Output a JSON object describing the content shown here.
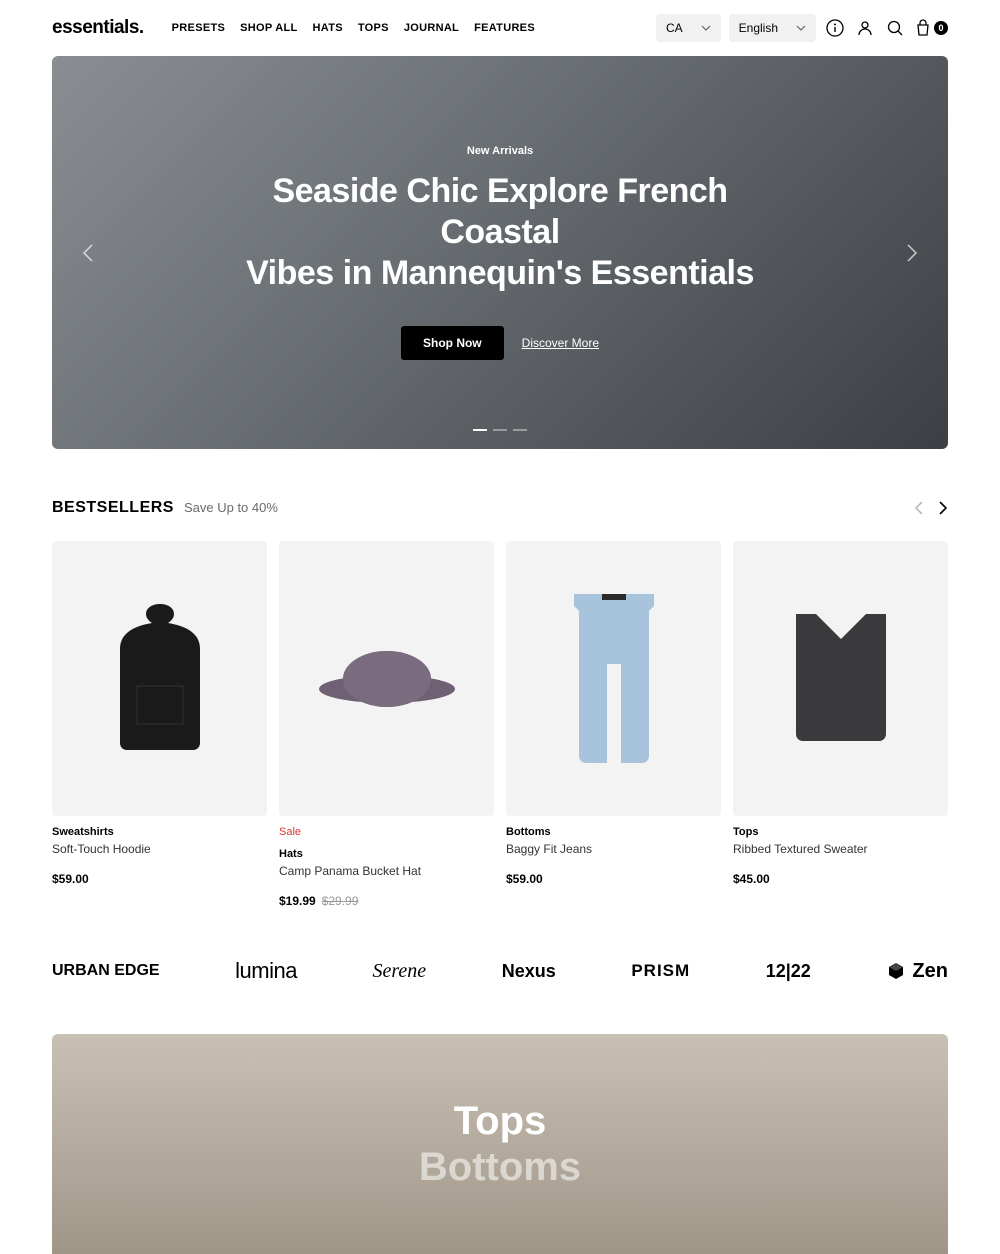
{
  "header": {
    "logo": "essentials.",
    "nav": [
      "PRESETS",
      "SHOP ALL",
      "HATS",
      "TOPS",
      "JOURNAL",
      "FEATURES"
    ],
    "country": "CA",
    "language": "English",
    "cart_count": "0"
  },
  "hero": {
    "kicker": "New Arrivals",
    "title_line1": "Seaside Chic Explore French Coastal",
    "title_line2": "Vibes in Mannequin's Essentials",
    "cta_primary": "Shop Now",
    "cta_secondary": "Discover More"
  },
  "bestsellers": {
    "title": "BESTSELLERS",
    "subtitle": "Save Up to 40%",
    "products": [
      {
        "sale": "",
        "category": "Sweatshirts",
        "name": "Soft-Touch Hoodie",
        "price": "$59.00",
        "old_price": ""
      },
      {
        "sale": "Sale",
        "category": "Hats",
        "name": "Camp Panama Bucket Hat",
        "price": "$19.99",
        "old_price": "$29.99"
      },
      {
        "sale": "",
        "category": "Bottoms",
        "name": "Baggy Fit Jeans",
        "price": "$59.00",
        "old_price": ""
      },
      {
        "sale": "",
        "category": "Tops",
        "name": "Ribbed Textured Sweater",
        "price": "$45.00",
        "old_price": ""
      }
    ]
  },
  "brands": {
    "urban": "URBAN EDGE",
    "lumina": "lumina",
    "serene": "Serene",
    "nexus": "Nexus",
    "prism": "PRISM",
    "twelve": "12|22",
    "zen": "Zen"
  },
  "catbanner": {
    "line1": "Tops",
    "line2": "Bottoms"
  }
}
